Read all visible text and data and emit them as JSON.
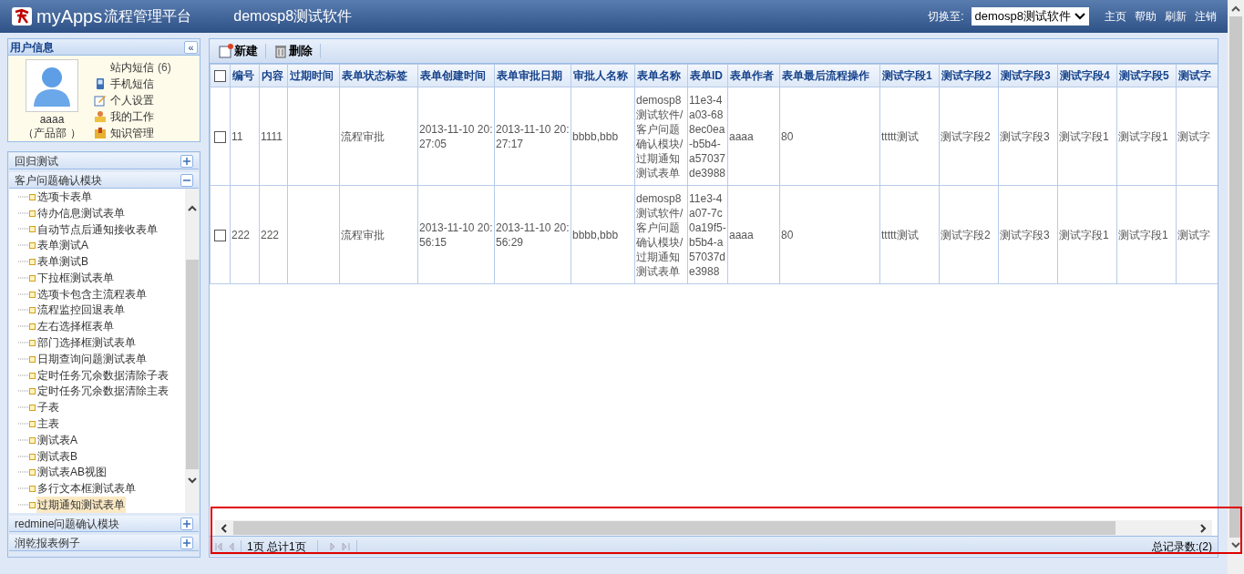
{
  "header": {
    "logo": "myApps",
    "product": "流程管理平台",
    "app_title": "demosp8测试软件",
    "switch_label": "切换至:",
    "switch_value": "demosp8测试软件",
    "links": [
      "主页",
      "帮助",
      "刷新",
      "注销"
    ]
  },
  "user_panel": {
    "title": "用户信息",
    "collapse": "«",
    "user": "aaaa",
    "dept": "（产品部 ）",
    "message": "站内短信",
    "message_count": "(6)",
    "links": [
      {
        "label": "手机短信",
        "kind": "phone"
      },
      {
        "label": "个人设置",
        "kind": "edit"
      },
      {
        "label": "我的工作",
        "kind": "work"
      },
      {
        "label": "知识管理",
        "kind": "knowledge"
      }
    ]
  },
  "modules": [
    {
      "title": "回归测试",
      "expanded": false
    },
    {
      "title": "客户问题确认模块",
      "expanded": true,
      "items": [
        {
          "label": "选项卡表单",
          "selected": false
        },
        {
          "label": "待办信息测试表单",
          "selected": false
        },
        {
          "label": "自动节点后通知接收表单",
          "selected": false
        },
        {
          "label": "表单测试A",
          "selected": false
        },
        {
          "label": "表单测试B",
          "selected": false
        },
        {
          "label": "下拉框测试表单",
          "selected": false
        },
        {
          "label": "选项卡包含主流程表单",
          "selected": false
        },
        {
          "label": "流程监控回退表单",
          "selected": false
        },
        {
          "label": "左右选择框表单",
          "selected": false
        },
        {
          "label": "部门选择框测试表单",
          "selected": false
        },
        {
          "label": "日期查询问题测试表单",
          "selected": false
        },
        {
          "label": "定时任务冗余数据清除子表",
          "selected": false
        },
        {
          "label": "定时任务冗余数据清除主表",
          "selected": false
        },
        {
          "label": "子表",
          "selected": false
        },
        {
          "label": "主表",
          "selected": false
        },
        {
          "label": "测试表A",
          "selected": false
        },
        {
          "label": "测试表B",
          "selected": false
        },
        {
          "label": "测试表AB视图",
          "selected": false
        },
        {
          "label": "多行文本框测试表单",
          "selected": false
        },
        {
          "label": "过期通知测试表单",
          "selected": true
        }
      ]
    },
    {
      "title": "redmine问题确认模块",
      "expanded": false
    },
    {
      "title": "润乾报表例子",
      "expanded": false
    }
  ],
  "toolbar": [
    {
      "label": "新建",
      "kind": "new"
    },
    {
      "label": "删除",
      "kind": "delete"
    }
  ],
  "table": {
    "select_all_checked": false,
    "columns": [
      "编号",
      "内容",
      "过期时间",
      "表单状态标签",
      "表单创建时间",
      "表单审批日期",
      "审批人名称",
      "表单名称",
      "表单ID",
      "表单作者",
      "表单最后流程操作",
      "测试字段1",
      "测试字段2",
      "测试字段3",
      "测试字段4",
      "测试字段5",
      "测试字"
    ],
    "rows": [
      {
        "checked": false,
        "cells": [
          "11",
          "1111",
          "",
          "流程审批",
          "2013-11-10 20:27:05",
          "2013-11-10 20:27:17",
          "bbbb,bbb",
          "demosp8测试软件/客户问题确认模块/过期通知测试表单",
          "11e3-4a03-688ec0ea-b5b4-a57037de3988",
          "aaaa",
          "80",
          "ttttt测试",
          "测试字段2",
          "测试字段3",
          "测试字段1",
          "测试字段1",
          "测试字"
        ]
      },
      {
        "checked": false,
        "cells": [
          "222",
          "222",
          "",
          "流程审批",
          "2013-11-10 20:56:15",
          "2013-11-10 20:56:29",
          "bbbb,bbb",
          "demosp8测试软件/客户问题确认模块/过期通知测试表单",
          "11e3-4a07-7c0a19f5-b5b4-a57037de3988",
          "aaaa",
          "80",
          "ttttt测试",
          "测试字段2",
          "测试字段3",
          "测试字段1",
          "测试字段1",
          "测试字"
        ]
      }
    ]
  },
  "pager": {
    "page_info": "1页 总计1页",
    "total": "总记录数:(2)"
  }
}
